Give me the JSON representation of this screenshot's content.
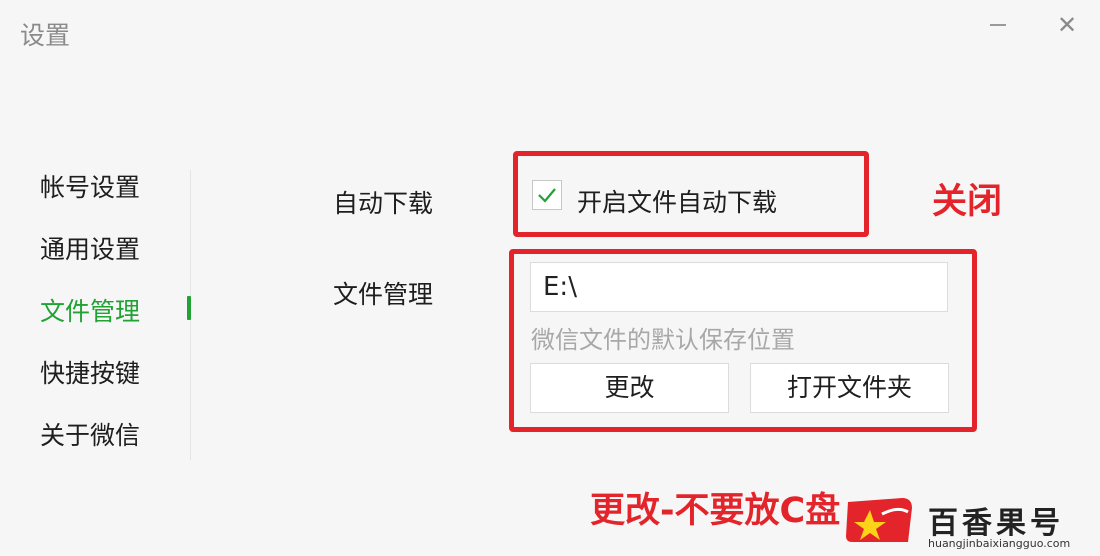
{
  "window": {
    "title": "设置",
    "minimize_icon": "minus-icon",
    "close_icon": "close-icon",
    "close_glyph": "✕"
  },
  "sidebar": {
    "items": [
      {
        "label": "帐号设置"
      },
      {
        "label": "通用设置"
      },
      {
        "label": "文件管理",
        "active": true
      },
      {
        "label": "快捷按键"
      },
      {
        "label": "关于微信"
      }
    ]
  },
  "auto_download": {
    "label": "自动下载",
    "checkbox_label": "开启文件自动下载",
    "checked": true
  },
  "file_management": {
    "label": "文件管理",
    "path_value": "E:\\",
    "hint": "微信文件的默认保存位置",
    "change_button": "更改",
    "open_folder_button": "打开文件夹"
  },
  "annotations": {
    "close_note": "关闭",
    "change_note": "更改-不要放C盘"
  },
  "watermark": {
    "name": "百香果号",
    "url": "huangjinbaixiangguo.com"
  },
  "colors": {
    "accent": "#20a234",
    "annotation_red": "#e3252b",
    "background": "#f6f6f6"
  }
}
